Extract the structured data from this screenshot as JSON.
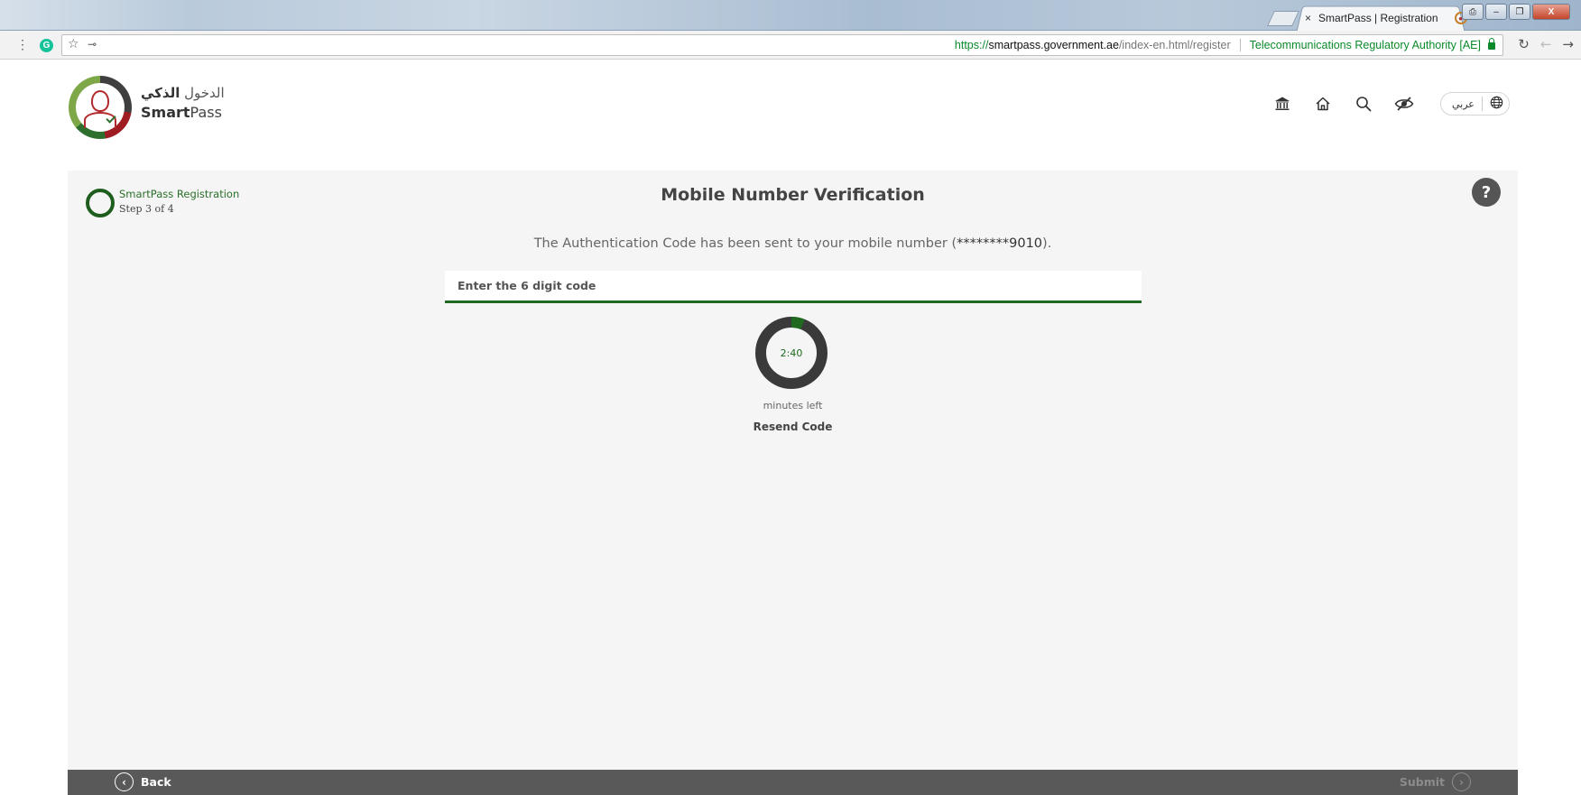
{
  "browser": {
    "tab_title": "SmartPass | Registration",
    "tab_close": "×",
    "url_scheme": "https://",
    "url_host": "smartpass.government.ae",
    "url_path": "/index-en.html/register",
    "cert_org": "Telecommunications Regulatory Authority [AE]",
    "menu_glyph": "⋮",
    "grammarly_glyph": "G",
    "key_glyph": "⊸",
    "window_buttons": [
      "⎙",
      "–",
      "❐",
      "X"
    ]
  },
  "header": {
    "logo_arabic_prefix": "الدخول",
    "logo_arabic_bold": "الذكي",
    "logo_bold": "Smart",
    "logo_rest": "Pass",
    "language_label": "عربي"
  },
  "icons": {
    "ministry": "bank-icon",
    "home": "home-icon",
    "search": "search-icon",
    "accessibility": "eye-slash-icon",
    "language": "globe-icon",
    "help": "help-icon"
  },
  "progress": {
    "title": "SmartPass Registration",
    "step": "Step 3 of 4"
  },
  "main": {
    "title": "Mobile Number Verification",
    "sent_message_prefix": "The Authentication Code has been sent to your mobile number (",
    "masked_number": "********9010",
    "sent_message_suffix": ").",
    "code_placeholder": "Enter the 6 digit code",
    "code_value": "",
    "help_label": "?"
  },
  "timer": {
    "display": "2:40",
    "label": "minutes left",
    "fraction_elapsed": 0.06,
    "ring_color": "#3a3a3a",
    "elapsed_color": "#1f6a1f"
  },
  "actions": {
    "resend_label": "Resend Code",
    "back_label": "Back",
    "submit_label": "Submit",
    "back_arrow": "‹",
    "submit_arrow": "›"
  },
  "colors": {
    "accent_green": "#1f6a1f",
    "footer_bg": "#595959",
    "panel_bg": "#f5f5f5"
  }
}
